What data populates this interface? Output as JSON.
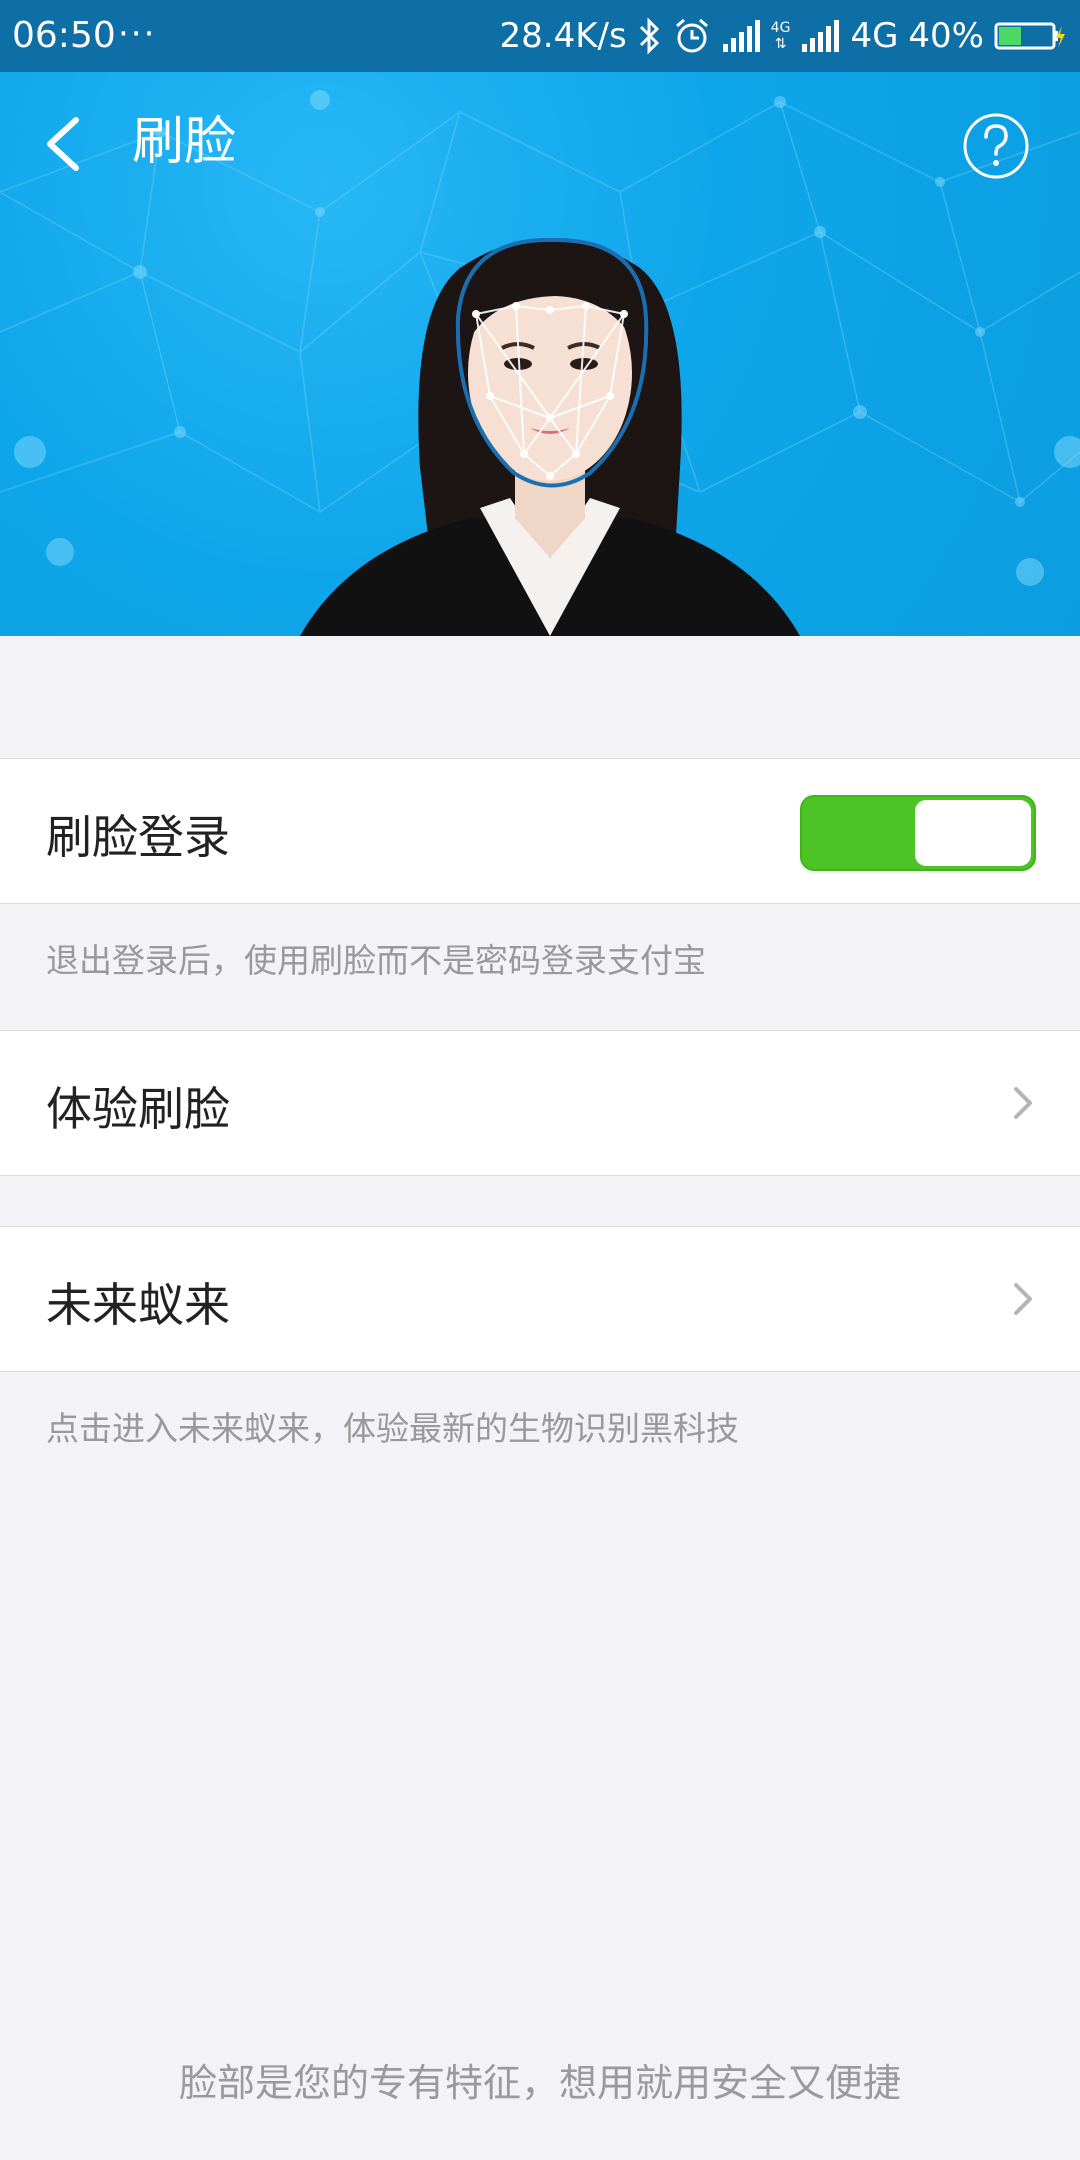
{
  "status_bar": {
    "time": "06:50",
    "more": "···",
    "speed": "28.4K/s",
    "network_label": "4G",
    "network_mini_label": "4G",
    "battery": "40%"
  },
  "header": {
    "title": "刷脸"
  },
  "settings": {
    "face_login": {
      "label": "刷脸登录",
      "enabled": true,
      "hint": "退出登录后，使用刷脸而不是密码登录支付宝"
    },
    "try_face": {
      "label": "体验刷脸"
    },
    "future": {
      "label": "未来蚁来",
      "hint": "点击进入未来蚁来，体验最新的生物识别黑科技"
    }
  },
  "footer": {
    "text": "脸部是您的专有特征，想用就用安全又便捷"
  },
  "colors": {
    "accent": "#0ea6ea",
    "toggle_on": "#4cc425",
    "status_bar": "#0d6fa6"
  }
}
